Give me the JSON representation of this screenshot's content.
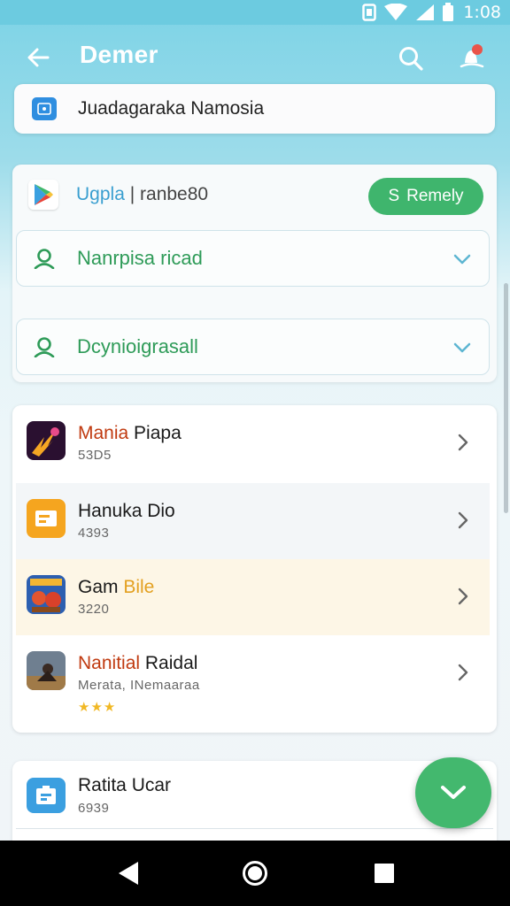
{
  "status_bar": {
    "time": "1:08"
  },
  "app_bar": {
    "title": "Demer"
  },
  "banner": {
    "text": "Juadagaraka Namosia"
  },
  "store": {
    "name": "Ugpla",
    "separator": "|",
    "id": "ranbe80",
    "button_label": "Remely",
    "button_icon": "S"
  },
  "dropdowns": [
    {
      "label": "Nanrpisa ricad"
    },
    {
      "label": "Dcynioigrasall"
    }
  ],
  "list_items": [
    {
      "title_a": "Mania",
      "title_b": " Piapa",
      "sub": "53D5"
    },
    {
      "title_a": "Hanuka Dio",
      "title_b": "",
      "sub": "4393"
    },
    {
      "title_a": "Gam ",
      "title_b": "Bile",
      "sub": "3220"
    },
    {
      "title_a": "Nanitial",
      "title_b": " Raidal",
      "sub": "Merata, INemaaraa",
      "stars": "★★★"
    }
  ],
  "bottom_item": {
    "title": "Ratita Ucar",
    "sub": "6939"
  },
  "colors": {
    "accent_green": "#3fb56d",
    "accent_blue": "#3a9fd0",
    "header_bg": "#6ccbe0",
    "highlight_row": "#fdf6e6",
    "selected_row": "#f3f6f8"
  },
  "icons": {
    "back": "arrow-left-icon",
    "search": "search-icon",
    "notifications": "notification-bell-icon",
    "fab": "chevron-down-icon"
  }
}
